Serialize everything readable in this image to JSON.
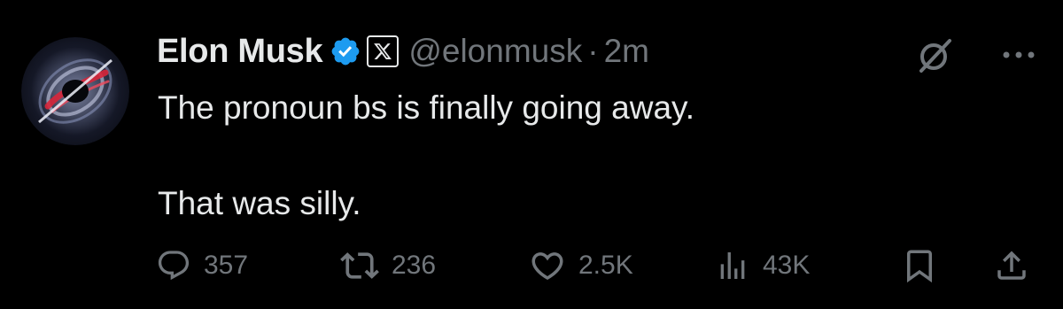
{
  "tweet": {
    "author": {
      "name": "Elon Musk",
      "handle": "@elonmusk",
      "verified_icon": "verified-badge-icon",
      "affiliate_icon": "x-logo-icon"
    },
    "separator": "·",
    "time": "2m",
    "lines": [
      "The pronoun bs is finally going away.",
      "That was silly."
    ],
    "actions": {
      "replies": "357",
      "retweets": "236",
      "likes": "2.5K",
      "views": "43K"
    }
  },
  "colors": {
    "background": "#000000",
    "text_primary": "#e7e9ea",
    "text_secondary": "#71767b",
    "verified_blue": "#1d9bf0"
  }
}
